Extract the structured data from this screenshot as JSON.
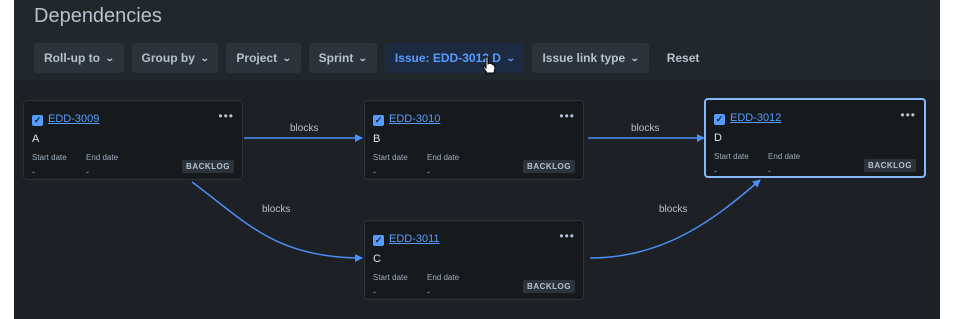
{
  "header": {
    "title": "Dependencies"
  },
  "toolbar": {
    "rollup": "Roll-up to",
    "groupby": "Group by",
    "project": "Project",
    "sprint": "Sprint",
    "issue": "Issue: EDD-3012 D",
    "linktype": "Issue link type",
    "reset": "Reset"
  },
  "cards": {
    "c3009": {
      "key": "EDD-3009",
      "name": "A",
      "start_label": "Start date",
      "end_label": "End date",
      "start": "-",
      "end": "-",
      "status": "BACKLOG"
    },
    "c3010": {
      "key": "EDD-3010",
      "name": "B",
      "start_label": "Start date",
      "end_label": "End date",
      "start": "-",
      "end": "-",
      "status": "BACKLOG"
    },
    "c3012": {
      "key": "EDD-3012",
      "name": "D",
      "start_label": "Start date",
      "end_label": "End date",
      "start": "-",
      "end": "-",
      "status": "BACKLOG"
    },
    "c3011": {
      "key": "EDD-3011",
      "name": "C",
      "start_label": "Start date",
      "end_label": "End date",
      "start": "-",
      "end": "-",
      "status": "BACKLOG"
    }
  },
  "edges": {
    "a_b": "blocks",
    "b_d": "blocks",
    "a_c": "blocks",
    "c_d": "blocks"
  },
  "colors": {
    "accent": "#579dff",
    "edge": "#4c8ef7",
    "panel_bg": "#1d2125",
    "card_bg": "#161a1d"
  }
}
